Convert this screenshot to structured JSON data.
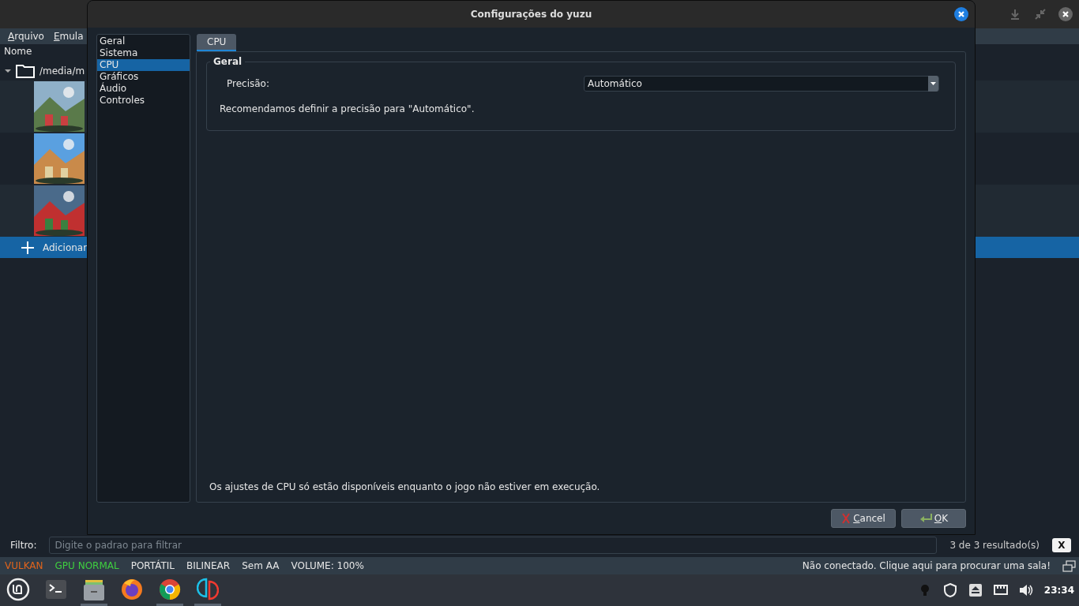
{
  "main_window": {
    "menu": [
      "Arquivo",
      "Emula"
    ],
    "column_header": "Nome",
    "tree": {
      "label": "/media/m",
      "expanded": true
    },
    "add_row": {
      "label": "Adicionar",
      "selected": true
    },
    "filter": {
      "label": "Filtro:",
      "placeholder": "Digite o padrao para filtrar",
      "results": "3 de 3 resultado(s)",
      "clear": "X"
    },
    "status_bar": {
      "items": [
        {
          "label": "VULKAN",
          "color": "#e0641c"
        },
        {
          "label": "GPU NORMAL",
          "color": "#3fcf3f"
        },
        {
          "label": "PORTÁTIL",
          "color": "#e6e6e6"
        },
        {
          "label": "BILINEAR",
          "color": "#e6e6e6"
        },
        {
          "label": "Sem AA",
          "color": "#e6e6e6"
        },
        {
          "label": "VOLUME: 100%",
          "color": "#e6e6e6"
        }
      ],
      "room": "Não conectado. Clique aqui para procurar uma sala!"
    }
  },
  "dialog": {
    "title": "Configurações do yuzu",
    "sidebar": [
      {
        "label": "Geral",
        "selected": false
      },
      {
        "label": "Sistema",
        "selected": false
      },
      {
        "label": "CPU",
        "selected": true
      },
      {
        "label": "Gráficos",
        "selected": false
      },
      {
        "label": "Áudio",
        "selected": false
      },
      {
        "label": "Controles",
        "selected": false
      }
    ],
    "tabs": [
      {
        "label": "CPU",
        "selected": true
      }
    ],
    "group": {
      "title": "Geral",
      "field_label": "Precisão:",
      "value": "Automático",
      "hint": "Recomendamos definir a precisão para \"Automático\"."
    },
    "note": "Os ajustes de CPU só estão disponíveis enquanto o jogo não estiver em execução.",
    "buttons": [
      {
        "kind": "cancel",
        "label": "Cancel"
      },
      {
        "kind": "ok",
        "label": "OK"
      }
    ]
  },
  "taskbar": {
    "clock": "23:34"
  }
}
